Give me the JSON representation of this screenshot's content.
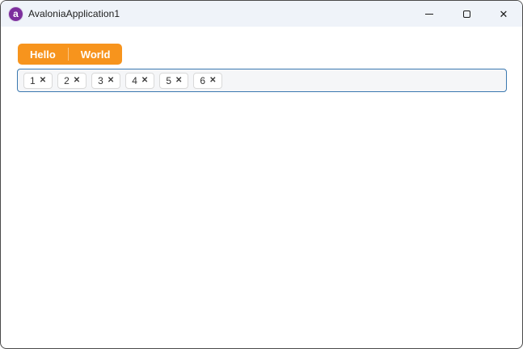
{
  "window": {
    "title": "AvaloniaApplication1",
    "logo_letter": "a"
  },
  "titlebar_controls": {
    "minimize_icon": "minimize-bar",
    "maximize_icon": "outline-square",
    "close_glyph": "✕"
  },
  "tabs": {
    "items": [
      {
        "label": "Hello"
      },
      {
        "label": "World"
      }
    ]
  },
  "chips": {
    "remove_glyph": "✕",
    "items": [
      {
        "label": "1"
      },
      {
        "label": "2"
      },
      {
        "label": "3"
      },
      {
        "label": "4"
      },
      {
        "label": "5"
      },
      {
        "label": "6"
      }
    ]
  },
  "colors": {
    "accent_orange": "#F7941D",
    "selection_border_blue": "#3A78B0",
    "titlebar_bg": "#EFF3F9",
    "window_border": "#4A4A4A",
    "chip_border": "#D9D9D9",
    "chip_bg": "#FFFFFF",
    "chips_box_bg": "#F5F6F8",
    "logo_purple": "#7D2F9D",
    "tab_text": "#FFFFFF"
  }
}
